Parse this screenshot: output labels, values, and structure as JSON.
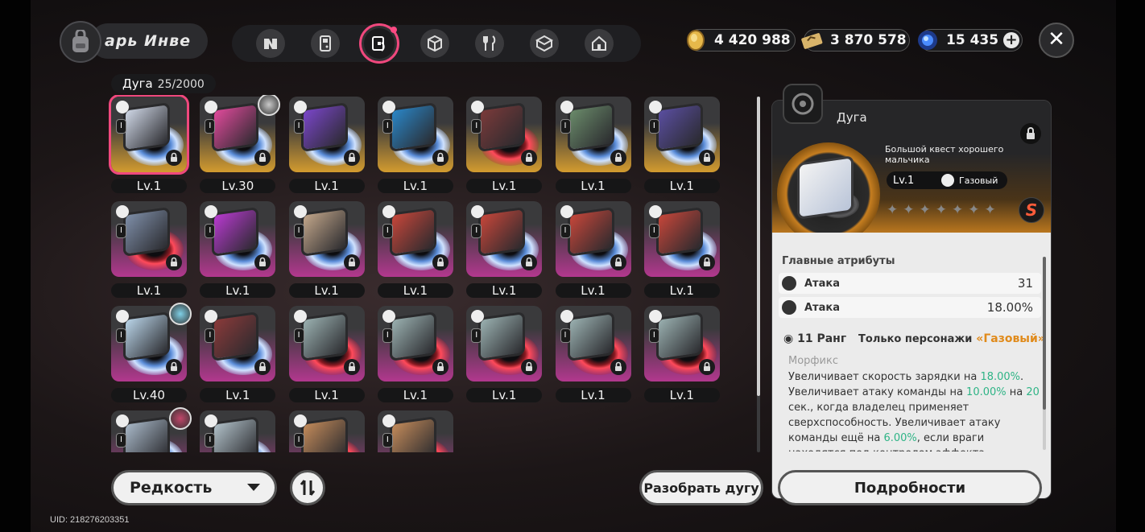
{
  "header": {
    "bag_label": "арь  Инве",
    "tabs": [
      "tab-n",
      "tab-console",
      "tab-disc",
      "tab-cube",
      "tab-food",
      "tab-box",
      "tab-house"
    ],
    "currencies": [
      {
        "name": "gold-coin-icon",
        "value": "4 420 988",
        "color": "#e6b84a"
      },
      {
        "name": "ticket-icon",
        "value": "3 870 578",
        "color": "#d8b46a"
      },
      {
        "name": "crystal-icon",
        "value": "15 435",
        "color": "#4a8cff"
      }
    ],
    "close": "✕"
  },
  "grid": {
    "title": "Дуга",
    "count": "25/2000",
    "cards": [
      {
        "level": "Lv.1",
        "rarity": "gold",
        "selected": true,
        "disc": "blue",
        "art": "#cfd7e6",
        "avatar": false
      },
      {
        "level": "Lv.30",
        "rarity": "gold",
        "selected": false,
        "disc": "blue",
        "art": "#e04a9b",
        "avatar": true,
        "avatar_color": "#c9c9c9"
      },
      {
        "level": "Lv.1",
        "rarity": "gold",
        "selected": false,
        "disc": "blue",
        "art": "#7a46c9",
        "avatar": false
      },
      {
        "level": "Lv.1",
        "rarity": "gold",
        "selected": false,
        "disc": "blue",
        "art": "#2a86c7",
        "avatar": false
      },
      {
        "level": "Lv.1",
        "rarity": "gold",
        "selected": false,
        "disc": "red",
        "art": "#7a3a3a",
        "avatar": false
      },
      {
        "level": "Lv.1",
        "rarity": "gold",
        "selected": false,
        "disc": "blue",
        "art": "#6a8a6a",
        "avatar": false
      },
      {
        "level": "Lv.1",
        "rarity": "gold",
        "selected": false,
        "disc": "blue",
        "art": "#5a4ea0",
        "avatar": false
      },
      {
        "level": "Lv.1",
        "rarity": "purple",
        "selected": false,
        "disc": "red",
        "art": "#7e8ea8",
        "avatar": false
      },
      {
        "level": "Lv.1",
        "rarity": "purple",
        "selected": false,
        "disc": "blue",
        "art": "#b83ad0",
        "avatar": false
      },
      {
        "level": "Lv.1",
        "rarity": "purple",
        "selected": false,
        "disc": "blue",
        "art": "#c2a68a",
        "avatar": false
      },
      {
        "level": "Lv.1",
        "rarity": "purple",
        "selected": false,
        "disc": "blue",
        "art": "#c6463a",
        "avatar": false
      },
      {
        "level": "Lv.1",
        "rarity": "purple",
        "selected": false,
        "disc": "blue",
        "art": "#c6463a",
        "avatar": false
      },
      {
        "level": "Lv.1",
        "rarity": "purple",
        "selected": false,
        "disc": "blue",
        "art": "#c6463a",
        "avatar": false
      },
      {
        "level": "Lv.1",
        "rarity": "purple",
        "selected": false,
        "disc": "blue",
        "art": "#c6463a",
        "avatar": false
      },
      {
        "level": "Lv.40",
        "rarity": "purple",
        "selected": false,
        "disc": "blue",
        "art": "#b9d4e8",
        "avatar": true,
        "avatar_color": "#7fd0e6"
      },
      {
        "level": "Lv.1",
        "rarity": "purple",
        "selected": false,
        "disc": "blue",
        "art": "#8a3a3a",
        "avatar": false
      },
      {
        "level": "Lv.1",
        "rarity": "purple",
        "selected": false,
        "disc": "red",
        "art": "#9ab0b0",
        "avatar": false
      },
      {
        "level": "Lv.1",
        "rarity": "purple",
        "selected": false,
        "disc": "red",
        "art": "#9ab0b0",
        "avatar": false
      },
      {
        "level": "Lv.1",
        "rarity": "purple",
        "selected": false,
        "disc": "red",
        "art": "#9ab0b0",
        "avatar": false
      },
      {
        "level": "Lv.1",
        "rarity": "purple",
        "selected": false,
        "disc": "red",
        "art": "#9ab0b0",
        "avatar": false
      },
      {
        "level": "Lv.1",
        "rarity": "purple",
        "selected": false,
        "disc": "red",
        "art": "#9ab0b0",
        "avatar": false
      },
      {
        "level": "",
        "rarity": "purple",
        "selected": false,
        "disc": "blue",
        "art": "#a8b8c8",
        "avatar": true,
        "avatar_color": "#c2466a"
      },
      {
        "level": "",
        "rarity": "purple",
        "selected": false,
        "disc": "blue",
        "art": "#b0c0c8",
        "avatar": false
      },
      {
        "level": "",
        "rarity": "purple",
        "selected": false,
        "disc": "red",
        "art": "#c28a5a",
        "avatar": false
      },
      {
        "level": "",
        "rarity": "purple",
        "selected": false,
        "disc": "red",
        "art": "#c28a5a",
        "avatar": false
      }
    ]
  },
  "controls": {
    "rarity_label": "Редкость",
    "dismantle_label": "Разобрать дугу",
    "details_label": "Подробности",
    "uid": "UID: 218276203351"
  },
  "panel": {
    "title": "Дуга",
    "name": "Большой квест хорошего мальчика",
    "level": "Lv.1",
    "attribute": "Газовый",
    "stars": [
      "✦",
      "✦",
      "✦",
      "✦",
      "✦",
      "✦",
      "✦"
    ],
    "rank_badge": "S",
    "main_attrs_title": "Главные атрибуты",
    "attrs": [
      {
        "name": "Атака",
        "value": "31"
      },
      {
        "name": "Атака",
        "value": "18.00%"
      }
    ],
    "rank": "11 Ранг",
    "only_chars": "Только персонажи",
    "only_attr": "«Газовый»",
    "skill_name": "Морфикс",
    "desc_parts": [
      {
        "t": "Увеличивает скорость зарядки на ",
        "g": false
      },
      {
        "t": "18.00%",
        "g": true
      },
      {
        "t": ". Увеличивает атаку команды на ",
        "g": false
      },
      {
        "t": "10.00%",
        "g": true
      },
      {
        "t": " на ",
        "g": false
      },
      {
        "t": "20",
        "g": true
      },
      {
        "t": " сек., когда владелец применяет сверхспособность. Увеличивает атаку команды ещё на ",
        "g": false
      },
      {
        "t": "6.00%",
        "g": true
      },
      {
        "t": ", если враги находятся под контролем эффекта",
        "g": false
      }
    ]
  }
}
